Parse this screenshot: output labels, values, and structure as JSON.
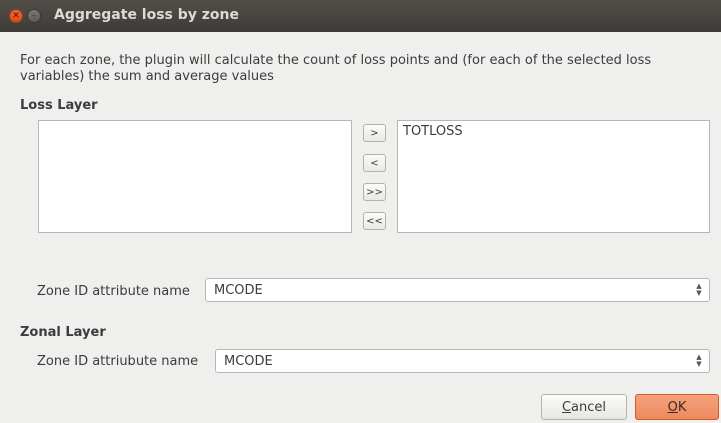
{
  "window": {
    "title": "Aggregate loss by zone",
    "close_glyph": "✕",
    "minimize_glyph": "–"
  },
  "description": "For each zone, the plugin will calculate the count of loss points and (for each of the selected loss variables) the sum and average values",
  "loss_layer": {
    "label": "Loss Layer",
    "available_items": [],
    "selected_items": [
      "TOTLOSS"
    ],
    "transfer_buttons": {
      "add": ">",
      "remove": "<",
      "add_all": ">>",
      "remove_all": "<<"
    },
    "zone_id_label": "Zone ID attribute name",
    "zone_id_value": "MCODE"
  },
  "zonal_layer": {
    "label": "Zonal Layer",
    "zone_id_label": "Zone ID attriubute name",
    "zone_id_value": "MCODE"
  },
  "buttons": {
    "cancel_mnemonic": "C",
    "cancel_rest": "ancel",
    "ok_mnemonic": "O",
    "ok_rest": "K"
  },
  "colors": {
    "titlebar": "#3d3c38",
    "close_button": "#dd4814",
    "ok_button": "#ec8a5e",
    "background": "#efefee"
  }
}
